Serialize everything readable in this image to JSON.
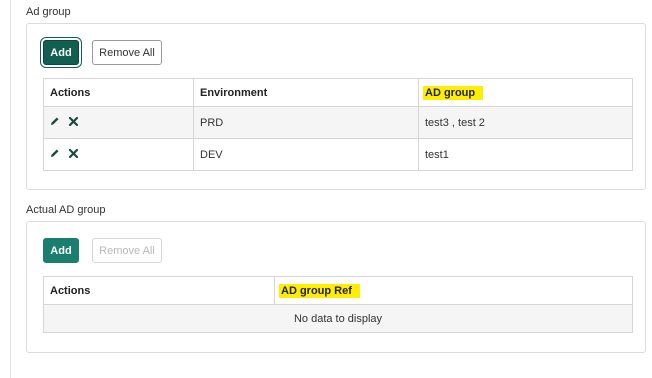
{
  "ad_group_section": {
    "label": "Ad group",
    "add_label": "Add",
    "remove_all_label": "Remove All",
    "columns": [
      "Actions",
      "Environment",
      "AD group"
    ],
    "rows": [
      {
        "environment": "PRD",
        "ad_group": "test3 , test 2"
      },
      {
        "environment": "DEV",
        "ad_group": "test1"
      }
    ]
  },
  "actual_ad_group_section": {
    "label": "Actual AD group",
    "add_label": "Add",
    "remove_all_label": "Remove All",
    "columns": [
      "Actions",
      "AD group Ref"
    ],
    "empty_text": "No data to display"
  },
  "colors": {
    "primary": "#1a7f6e",
    "highlight": "#ffee00",
    "icon": "#1b4b3f"
  },
  "icons": {
    "edit": "pencil-icon",
    "delete": "x-icon"
  }
}
